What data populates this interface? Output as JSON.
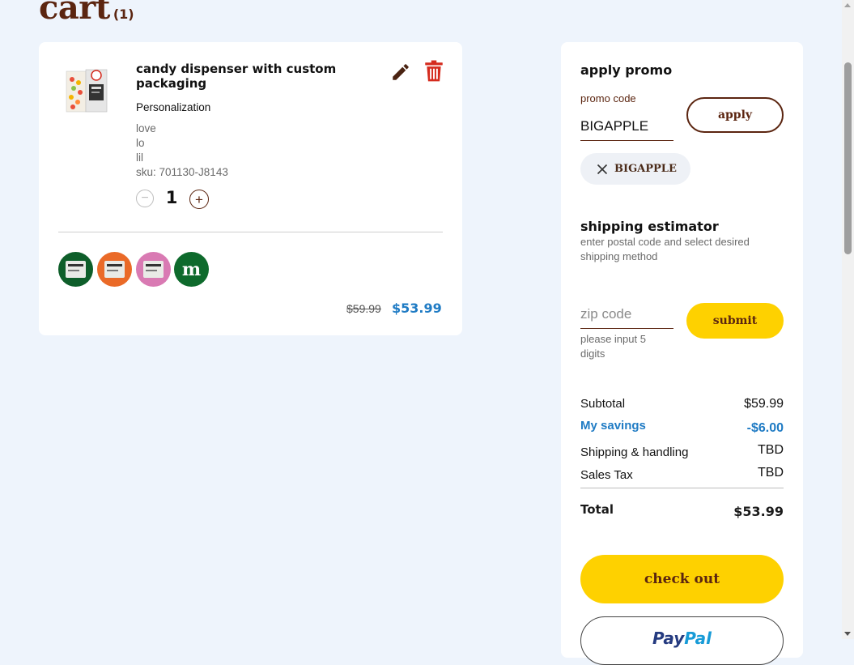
{
  "page": {
    "title": "cart",
    "count": "(1)"
  },
  "item": {
    "name": "candy dispenser with custom packaging",
    "personalization_label": "Personalization",
    "personalization_lines": [
      "love",
      "lo",
      "lil"
    ],
    "sku": "sku: 701130-J8143",
    "quantity": "1",
    "qty_minus": "−",
    "qty_plus": "+",
    "price_original": "$59.99",
    "price_current": "$53.99",
    "swatches": [
      {
        "name": "green-label-swatch",
        "color": "#0e5e2a"
      },
      {
        "name": "orange-label-swatch",
        "color": "#ea6a28"
      },
      {
        "name": "pink-label-swatch",
        "color": "#d97ab3"
      },
      {
        "name": "green-m-swatch",
        "color": "#0e6a2c",
        "text": "m"
      }
    ],
    "icons": {
      "edit": "pencil-icon",
      "delete": "trash-icon"
    }
  },
  "promo": {
    "heading": "apply promo",
    "label": "promo code",
    "value": "BIGAPPLE",
    "apply_label": "apply",
    "applied_code": "BIGAPPLE"
  },
  "shipping": {
    "heading": "shipping estimator",
    "description": "enter postal code and select desired shipping method",
    "zip_placeholder": "zip code",
    "hint": "please input 5 digits",
    "submit_label": "submit"
  },
  "summary": {
    "subtotal_label": "Subtotal",
    "subtotal_value": "$59.99",
    "savings_label": "My savings",
    "savings_value": "-$6.00",
    "shipping_label": "Shipping & handling",
    "shipping_value": "TBD",
    "tax_label": "Sales Tax",
    "tax_value": "TBD",
    "total_label": "Total",
    "total_value": "$53.99"
  },
  "actions": {
    "checkout_label": "check out",
    "paypal_part1": "Pay",
    "paypal_part2": "Pal"
  },
  "colors": {
    "brand_brown": "#5b2510",
    "brand_yellow": "#fed100",
    "price_blue": "#1f7bc4",
    "delete_red": "#d52b1e",
    "background": "#eef4fc"
  }
}
